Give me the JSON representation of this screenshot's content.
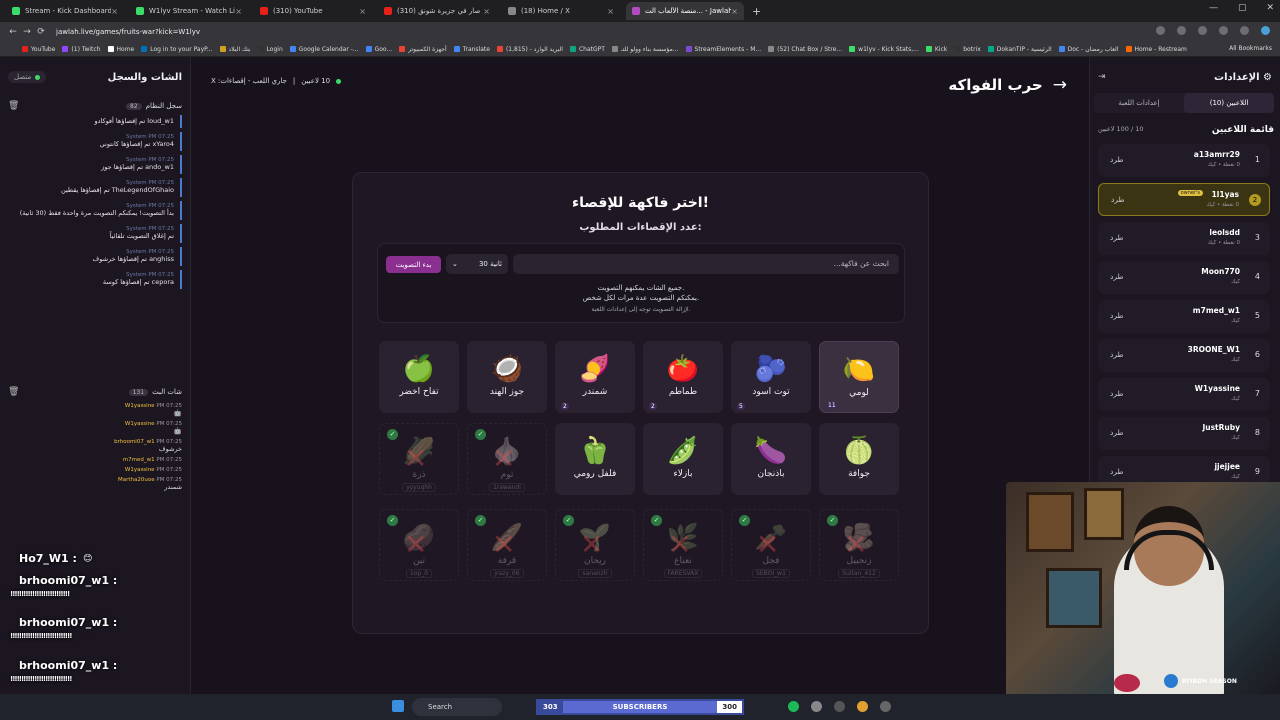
{
  "browser": {
    "tabs": [
      {
        "title": "Stream - Kick Dashboard",
        "color": "#3ddc6a"
      },
      {
        "title": "W1lyv Stream - Watch Live on",
        "color": "#3ddc6a"
      },
      {
        "title": "(310) YouTube",
        "color": "#e62117"
      },
      {
        "title": "(310) وش صار في جزيرة شونق",
        "color": "#e62117"
      },
      {
        "title": "(18) Home / X",
        "color": "#888888"
      },
      {
        "title": "منصة الألعاب الت... - Jawlah | جولة",
        "color": "#b04bc0"
      }
    ],
    "url": "jawlah.live/games/fruits-war?kick=W1lyv",
    "bookmarks": [
      "YouTube",
      "(1) Twitch",
      "Home",
      "Log in to your PayP...",
      "بنك البلاد",
      "Login",
      "Google Calendar -...",
      "Goo...",
      "أجهزة الكمبيوتر",
      "Translate",
      "البريد الوارد - (1,815)",
      "ChatGPT",
      "مؤسسة بناء وولو للتـ...",
      "StreamElements - M...",
      "(52) Chat Box / Stre...",
      "w1lyv - Kick Stats,...",
      "Kick",
      "botrix",
      "DokanTIP - الرئيسية",
      "Doc - العاب رمضان",
      "Home - Restream"
    ],
    "all_bookmarks": "All Bookmarks"
  },
  "left": {
    "title": "الشات والسجل",
    "status": "متصل",
    "system_log": {
      "title": "سجل النظام",
      "count": "82"
    },
    "system_messages": [
      {
        "meta": "",
        "text": "loud_w1 تم إقصاؤها أفوكادو"
      },
      {
        "meta": "System PM 07:25",
        "text": "xYaro4 تم إقصاؤها كانتوني"
      },
      {
        "meta": "System PM 07:25",
        "text": "ando_w1 تم إقصاؤها جوز"
      },
      {
        "meta": "System PM 07:25",
        "text": "TheLegendOfGhaio تم إقصاؤها يقطين"
      },
      {
        "meta": "System PM 07:25",
        "text": "بدأ التصويت! يمكنكم التصويت مرة واحدة فقط (30 ثانية)"
      },
      {
        "meta": "System PM 07:25",
        "text": "تم إغلاق التصويت تلقائياً"
      },
      {
        "meta": "System PM 07:25",
        "text": "anghiss تم إقصاؤها خرشوف"
      },
      {
        "meta": "System PM 07:25",
        "text": "cepora تم إقصاؤها كوسة"
      }
    ],
    "bot_chat": {
      "title": "شات البث",
      "count": "131"
    },
    "chat_messages": [
      {
        "time": "PM 07:25",
        "user": "W1yassine",
        "text": "🤖"
      },
      {
        "time": "PM 07:25",
        "user": "W1yassine",
        "text": "🤖"
      },
      {
        "time": "PM 07:25",
        "user": "brhoomi07_w1",
        "text": "خرشوف"
      },
      {
        "time": "PM 07:25",
        "user": "m7med_w1",
        "text": ""
      },
      {
        "time": "PM 07:25",
        "user": "W1yassine",
        "text": ""
      },
      {
        "time": "PM 07:25",
        "user": "Martha20uoe",
        "text": "شمندر"
      }
    ],
    "overlay": [
      {
        "user": "Ho7_W1 :",
        "msg": "😊"
      },
      {
        "user": "brhoomi07_w1 :",
        "msg": "!!!!!!!!!!!!!!!!!!!!!!!!!!!"
      },
      {
        "user": "brhoomi07_w1 :",
        "msg": "!!!!!!!!!!!!!!!!!!!!!!!!!!!!"
      },
      {
        "user": "brhoomi07_w1 :",
        "msg": "!!!!!!!!!!!!!!!!!!!!!!!!!!!!"
      },
      {
        "user": "Ho7_W1 :",
        "msg": "😊"
      }
    ]
  },
  "main": {
    "players_online": "10 لاعبين",
    "status": "جاري اللعب - إقصاءات: X",
    "game_title": "حرب الفواكه",
    "card_title": "اختر فاكهة للإقصاء!",
    "required_label": "عدد الإقصاءات المطلوب:",
    "search_placeholder": "ابحث عن فاكهة...",
    "time_option": "30 ثانية",
    "start_button": "بدء التصويت",
    "note_line1": "جميع الشات يمكنهم التصويت.",
    "note_line2": "يمكنكم التصويت عدة مرات لكل شخص.",
    "note_line3": "لإزالة التصويت توجه إلى إعدادات اللعبة."
  },
  "fruits_row1": [
    {
      "name": "لومي",
      "emoji": "🍋",
      "count": "11"
    },
    {
      "name": "توت اسود",
      "emoji": "🫐",
      "count": "5"
    },
    {
      "name": "طماطم",
      "emoji": "🍅",
      "count": "2"
    },
    {
      "name": "شمندر",
      "emoji": "🍠",
      "count": "2"
    },
    {
      "name": "جوز الهند",
      "emoji": "🥥",
      "count": ""
    },
    {
      "name": "تفاح اخضر",
      "emoji": "🍏",
      "count": ""
    }
  ],
  "fruits_row2": [
    {
      "name": "جوافة",
      "emoji": "🍈",
      "elim": false,
      "by": ""
    },
    {
      "name": "باذنجان",
      "emoji": "🍆",
      "elim": false,
      "by": ""
    },
    {
      "name": "بازلاء",
      "emoji": "🫛",
      "elim": false,
      "by": ""
    },
    {
      "name": "فلفل رومي",
      "emoji": "🫑",
      "elim": false,
      "by": ""
    },
    {
      "name": "ثوم",
      "emoji": "🧄",
      "elim": true,
      "by": "1rawandi"
    },
    {
      "name": "ذرة",
      "emoji": "🌽",
      "elim": true,
      "by": "yyyuqhh"
    }
  ],
  "fruits_row3": [
    {
      "name": "زنجبيل",
      "emoji": "🫚",
      "elim": true,
      "by": "Sultan_412"
    },
    {
      "name": "فجل",
      "emoji": "🥕",
      "elim": true,
      "by": "SEBOI_w1"
    },
    {
      "name": "نعناع",
      "emoji": "🌿",
      "elim": true,
      "by": "FARESVAX"
    },
    {
      "name": "ريحان",
      "emoji": "🌱",
      "elim": true,
      "by": "sananzh"
    },
    {
      "name": "قرفة",
      "emoji": "🥖",
      "elim": true,
      "by": "jrazy_06"
    },
    {
      "name": "تين",
      "emoji": "🥔",
      "elim": true,
      "by": "1op_0"
    }
  ],
  "right": {
    "title": "الإعدادات",
    "tab_players": "اللاعبين (10)",
    "tab_settings": "إعدادات اللعبة",
    "list_title": "قائمة اللاعبين",
    "list_count": "10 / 100 لاعبين",
    "kick_label": "طرد",
    "owner_badge": "owner's",
    "players": [
      {
        "rank": "1",
        "name": "a13amrr29",
        "sub": "0 نقطة • كيك"
      },
      {
        "rank": "2",
        "name": "1l1yas",
        "sub": "0 نقطة • كيك"
      },
      {
        "rank": "3",
        "name": "leolsdd",
        "sub": "0 نقطة • كيك"
      },
      {
        "rank": "4",
        "name": "Moon770",
        "sub": "كيك"
      },
      {
        "rank": "5",
        "name": "m7med_w1",
        "sub": "كيك"
      },
      {
        "rank": "6",
        "name": "3ROONE_W1",
        "sub": "كيك"
      },
      {
        "rank": "7",
        "name": "W1yassine",
        "sub": "كيك"
      },
      {
        "rank": "8",
        "name": "JustRuby",
        "sub": "كيك"
      },
      {
        "rank": "9",
        "name": "jjejjee",
        "sub": "كيك"
      }
    ]
  },
  "taskbar": {
    "search": "Search",
    "subs_left": "303",
    "subs_label": "SUBSCRIBERS",
    "subs_right": "300"
  },
  "webcam": {
    "brand": "RIYADH SEASON"
  }
}
